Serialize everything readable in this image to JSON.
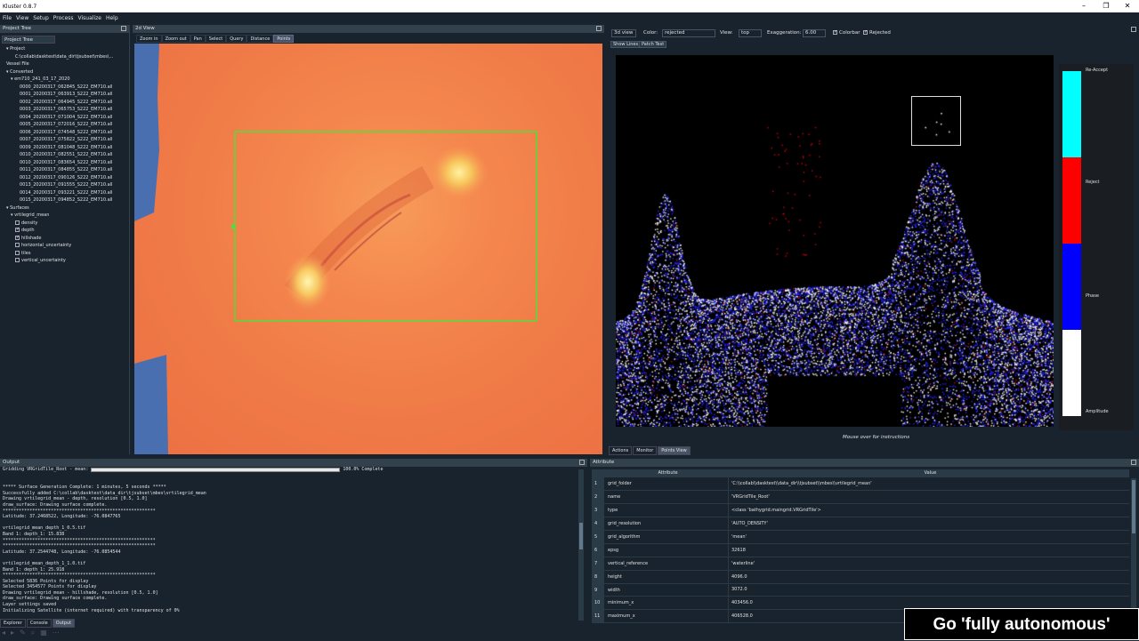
{
  "window": {
    "title": "Kluster 0.8.7"
  },
  "menu": [
    "File",
    "View",
    "Setup",
    "Process",
    "Visualize",
    "Help"
  ],
  "tree": {
    "dock_title": "Project Tree",
    "tab": "Project Tree",
    "items": [
      {
        "label": "Project",
        "indent": 1,
        "arrow": "▾"
      },
      {
        "label": "C:\\collab\\dasktest\\data_dir\\tjsubset\\mbes\\...",
        "indent": 3
      },
      {
        "label": "Vessel File",
        "indent": 1
      },
      {
        "label": "Converted",
        "indent": 1,
        "arrow": "▾"
      },
      {
        "label": "em710_241_03_17_2020",
        "indent": 2,
        "arrow": "▾"
      },
      {
        "label": "0000_20200317_062845_S222_EM710.all",
        "indent": 4
      },
      {
        "label": "0001_20200317_063913_S222_EM710.all",
        "indent": 4
      },
      {
        "label": "0002_20200317_064945_S222_EM710.all",
        "indent": 4
      },
      {
        "label": "0003_20200317_065753_S222_EM710.all",
        "indent": 4
      },
      {
        "label": "0004_20200317_071004_S222_EM710.all",
        "indent": 4
      },
      {
        "label": "0005_20200317_072016_S222_EM710.all",
        "indent": 4
      },
      {
        "label": "0006_20200317_074548_S222_EM710.all",
        "indent": 4
      },
      {
        "label": "0007_20200317_075822_S222_EM710.all",
        "indent": 4
      },
      {
        "label": "0009_20200317_081048_S222_EM710.all",
        "indent": 4
      },
      {
        "label": "0010_20200317_082551_S222_EM710.all",
        "indent": 4
      },
      {
        "label": "0010_20200317_083654_S222_EM710.all",
        "indent": 4
      },
      {
        "label": "0011_20200317_084855_S222_EM710.all",
        "indent": 4
      },
      {
        "label": "0012_20200317_090126_S222_EM710.all",
        "indent": 4
      },
      {
        "label": "0013_20200317_091555_S222_EM710.all",
        "indent": 4
      },
      {
        "label": "0014_20200317_093221_S222_EM710.all",
        "indent": 4
      },
      {
        "label": "0015_20200317_094852_S222_EM710.all",
        "indent": 4
      },
      {
        "label": "Surfaces",
        "indent": 1,
        "arrow": "▾"
      },
      {
        "label": "vrtilegrid_mean",
        "indent": 2,
        "arrow": "▾"
      },
      {
        "label": "density",
        "indent": 3,
        "check": false
      },
      {
        "label": "depth",
        "indent": 3,
        "check": true
      },
      {
        "label": "hillshade",
        "indent": 3,
        "check": true
      },
      {
        "label": "horizontal_uncertainty",
        "indent": 3,
        "check": false
      },
      {
        "label": "tiles",
        "indent": 3,
        "check": false
      },
      {
        "label": "vertical_uncertainty",
        "indent": 3,
        "check": false
      }
    ]
  },
  "zd": {
    "title": "2d View",
    "tools": [
      "Zoom in",
      "Zoom out",
      "Pan",
      "Select",
      "Query",
      "Distance",
      "Points"
    ],
    "active_tool": "Points"
  },
  "v3d": {
    "mode": "3d view",
    "color_label": "Color:",
    "color_value": "rejected",
    "view_label": "View:",
    "view_value": "top",
    "exag_label": "Exaggeration:",
    "exag_value": "6.00",
    "colorbar_label": "Colorbar",
    "colorbar_checked": true,
    "rejected_label": "Rejected",
    "rejected_checked": true,
    "show_lines": "Show Lines",
    "patch_test": "Patch Test",
    "hint": "Mouse over for instructions",
    "tabs": [
      "Actions",
      "Monitor",
      "Points View"
    ],
    "active_tab": "Points View",
    "colorbar": [
      {
        "label": "Re-Accept",
        "color": "#00ffff"
      },
      {
        "label": "Reject",
        "color": "#ff0000"
      },
      {
        "label": "Phase",
        "color": "#0000ff"
      },
      {
        "label": "Amplitude",
        "color": "#ffffff"
      }
    ]
  },
  "output": {
    "title": "Output",
    "progress_label": "Gridding VRGridTile_Root - mean:",
    "progress_pct": "100.0% Complete",
    "progress_value": 1.0,
    "lines": [
      "",
      "",
      "***** Surface Generation Complete: 1 minutes, 5 seconds *****",
      "Successfully added C:\\collab\\dasktest\\data_dir\\tjsubset\\mbes\\vrtilegrid_mean",
      "Drawing vrtilegrid_mean - depth, resolution [0.5, 1.0]",
      "draw_surface: Drawing surface complete.",
      "*********************************************************",
      "Latitude: 37.2468522, Longitude: -76.0847765",
      "",
      "vrtilegrid_mean_depth_1_0.5.tif",
      "Band 1: depth_1: 15.838",
      "*********************************************************",
      "*********************************************************",
      "Latitude: 37.2544748, Longitude: -76.0854544",
      "",
      "vrtilegrid_mean_depth_1_1.0.tif",
      "Band 1: depth_1: 25.918",
      "*********************************************************",
      "Selected 5836 Points for display",
      "Selected 3454577 Points for display",
      "Drawing vrtilegrid_mean - hillshade, resolution [0.5, 1.0]",
      "draw_surface: Drawing surface complete.",
      "Layer settings saved",
      "Initializing Satellite (internet required) with transparency of 0%"
    ],
    "tabs": [
      "Explorer",
      "Console",
      "Output"
    ],
    "active_tab": "Output"
  },
  "attribute": {
    "title": "Attribute",
    "col_attr": "Attribute",
    "col_val": "Value",
    "rows": [
      {
        "n": "1",
        "k": "grid_folder",
        "v": "'C:\\\\collab\\\\dasktest\\\\data_dir\\\\tjsubset\\\\mbes\\\\vrtilegrid_mean'"
      },
      {
        "n": "2",
        "k": "name",
        "v": "'VRGridTile_Root'"
      },
      {
        "n": "3",
        "k": "type",
        "v": "<class 'bathygrid.maingrid.VRGridTile'>"
      },
      {
        "n": "4",
        "k": "grid_resolution",
        "v": "'AUTO_DENSITY'"
      },
      {
        "n": "5",
        "k": "grid_algorithm",
        "v": "'mean'"
      },
      {
        "n": "6",
        "k": "epsg",
        "v": "32618"
      },
      {
        "n": "7",
        "k": "vertical_reference",
        "v": "'waterline'"
      },
      {
        "n": "8",
        "k": "height",
        "v": "4096.0"
      },
      {
        "n": "9",
        "k": "width",
        "v": "3072.0"
      },
      {
        "n": "10",
        "k": "minimum_x",
        "v": "403456.0"
      },
      {
        "n": "11",
        "k": "maximum_x",
        "v": "406528.0"
      }
    ]
  },
  "overlay": {
    "text": "Go 'fully autonomous'"
  }
}
